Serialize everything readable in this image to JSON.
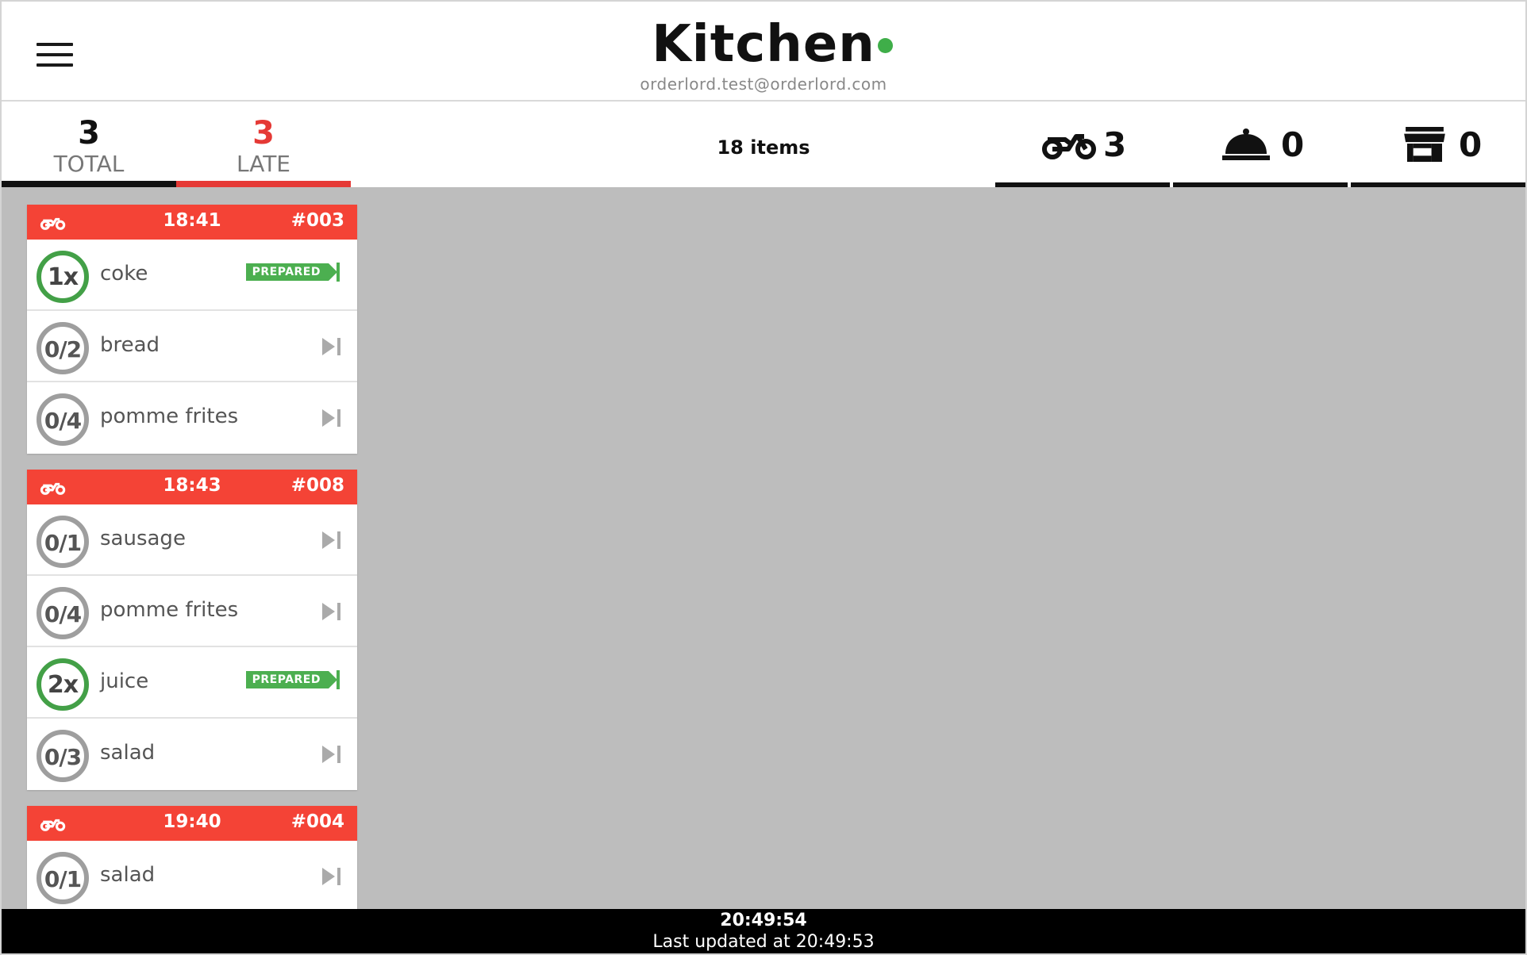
{
  "header": {
    "title": "Kitchen",
    "account_email": "orderlord.test@orderlord.com",
    "status_color": "#3fae49",
    "menu_icon": "hamburger-icon"
  },
  "summary": {
    "total": {
      "value": "3",
      "label": "TOTAL"
    },
    "late": {
      "value": "3",
      "label": "LATE",
      "color": "#e53935"
    },
    "items_count": "18 items",
    "filters": [
      {
        "icon": "motorcycle-icon",
        "count": "3"
      },
      {
        "icon": "cloche-icon",
        "count": "0"
      },
      {
        "icon": "store-icon",
        "count": "0"
      }
    ]
  },
  "orders": [
    {
      "icon": "motorcycle-icon",
      "time": "18:41",
      "number": "#003",
      "items": [
        {
          "qty": "1x",
          "name": "coke",
          "status": "PREPARED"
        },
        {
          "qty": "0/2",
          "name": "bread",
          "status": ""
        },
        {
          "qty": "0/4",
          "name": "pomme frites",
          "status": ""
        }
      ]
    },
    {
      "icon": "motorcycle-icon",
      "time": "18:43",
      "number": "#008",
      "items": [
        {
          "qty": "0/1",
          "name": "sausage",
          "status": ""
        },
        {
          "qty": "0/4",
          "name": "pomme frites",
          "status": ""
        },
        {
          "qty": "2x",
          "name": "juice",
          "status": "PREPARED"
        },
        {
          "qty": "0/3",
          "name": "salad",
          "status": ""
        }
      ]
    },
    {
      "icon": "motorcycle-icon",
      "time": "19:40",
      "number": "#004",
      "items": [
        {
          "qty": "0/1",
          "name": "salad",
          "status": ""
        }
      ]
    }
  ],
  "footer": {
    "clock": "20:49:54",
    "last_updated": "Last updated at 20:49:53"
  },
  "colors": {
    "order_header": "#f44336",
    "prepared": "#4caf50",
    "pending_ring": "#9e9e9e",
    "background": "#bdbdbd"
  }
}
